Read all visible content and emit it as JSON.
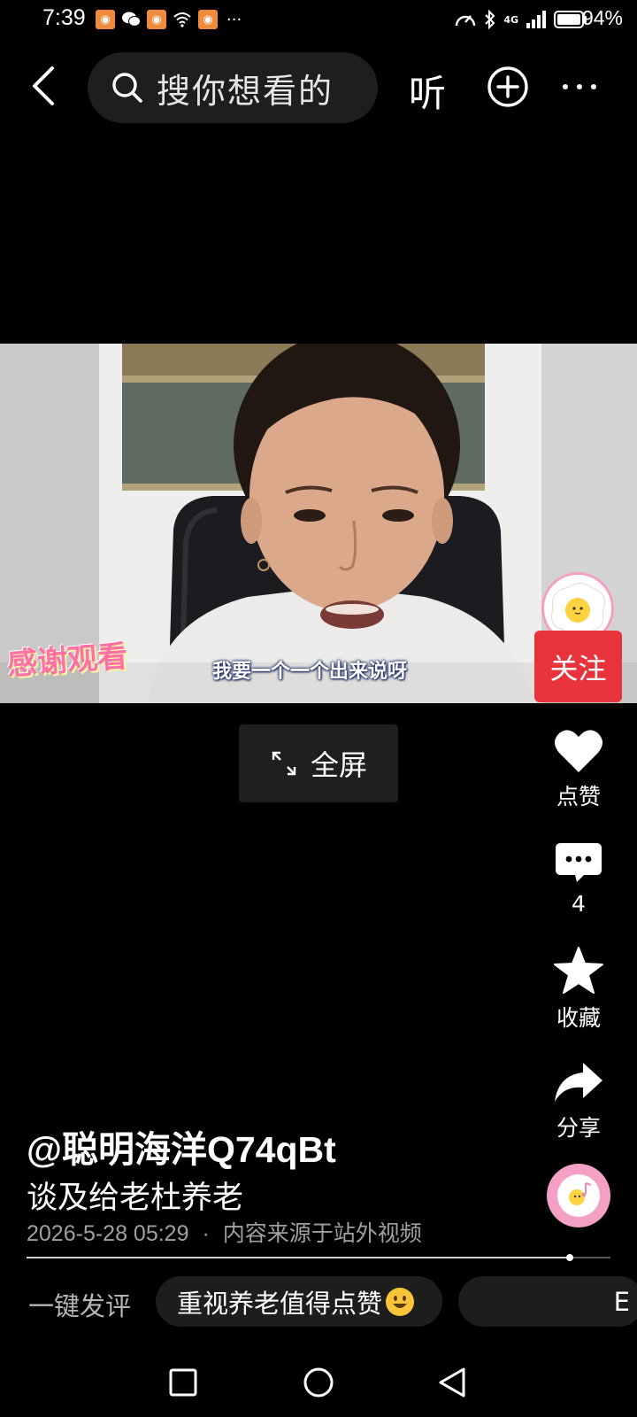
{
  "status_bar": {
    "time": "7:39",
    "more_notifs": "···",
    "signal": "4G",
    "battery": "94%"
  },
  "top_bar": {
    "search_placeholder": "搜你想看的",
    "listen_label": "听"
  },
  "video": {
    "subtitle": "我要一个一个出来说呀",
    "sticker_text": "感谢观看",
    "follow_label": "关注",
    "fullscreen_label": "全屏"
  },
  "rail": {
    "like_label": "点赞",
    "comment_count": "4",
    "favorite_label": "收藏",
    "share_label": "分享"
  },
  "info": {
    "author": "@聪明海洋Q74qBt",
    "title": "谈及给老杜养老",
    "date": "2026-5-28 05:29",
    "separator": "·",
    "source": "内容来源于站外视频",
    "progress": 0.93
  },
  "quick_comments": {
    "label": "一键发评",
    "chips": [
      "重视养老值得点赞",
      "E"
    ]
  },
  "colors": {
    "follow_red": "#e8333c",
    "avatar_pink": "#f3a0c4"
  }
}
